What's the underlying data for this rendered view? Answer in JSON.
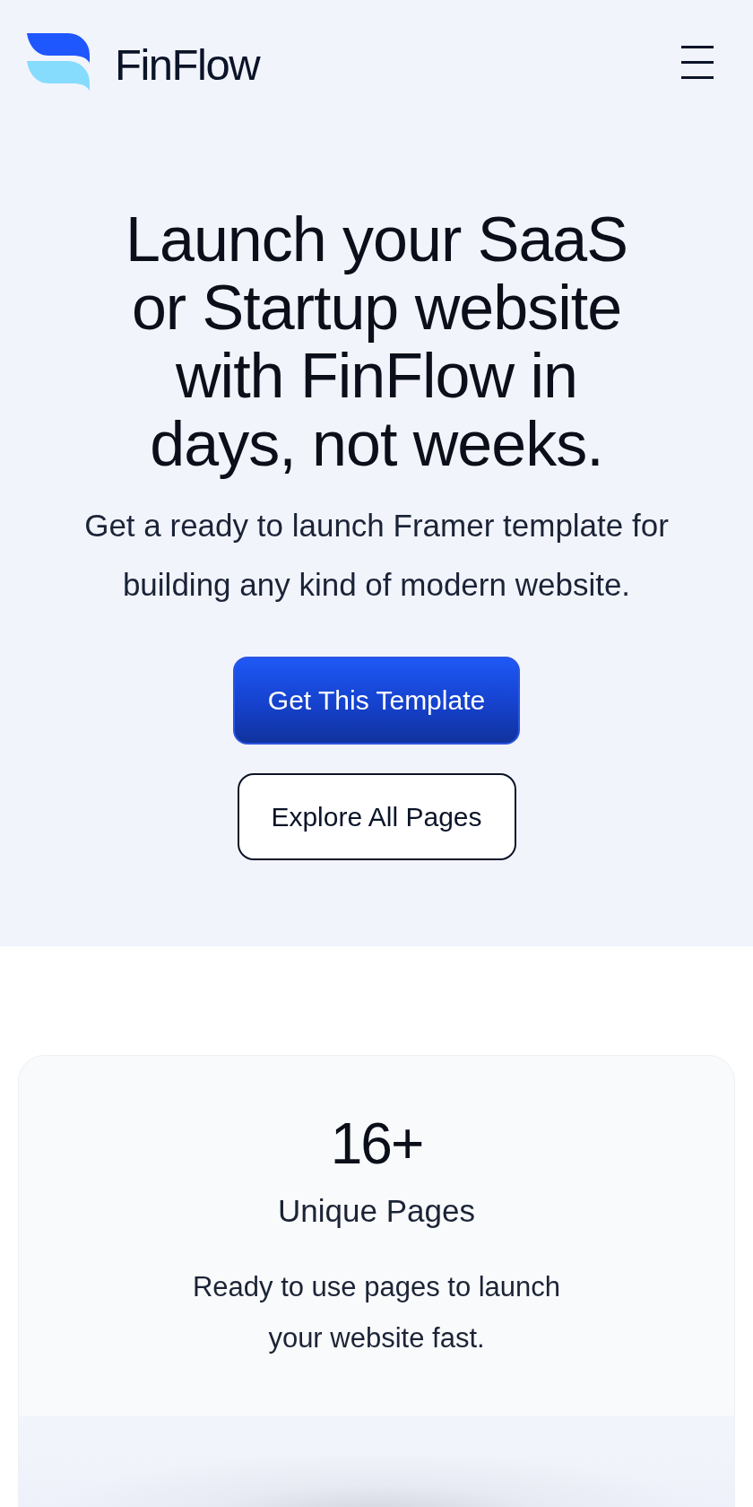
{
  "header": {
    "brand": "FinFlow"
  },
  "hero": {
    "heading": "Launch your SaaS or Startup website with FinFlow in days, not weeks.",
    "subtitle": "Get a ready to launch Framer template for building any kind of modern website.",
    "buttons": [
      {
        "label": "Get This Template",
        "kind": "primary"
      },
      {
        "label": "Explore All Pages",
        "kind": "secondary"
      }
    ]
  },
  "stats": [
    {
      "value": "16+",
      "title": "Unique Pages",
      "description": "Ready to use pages to launch your website fast."
    }
  ]
}
